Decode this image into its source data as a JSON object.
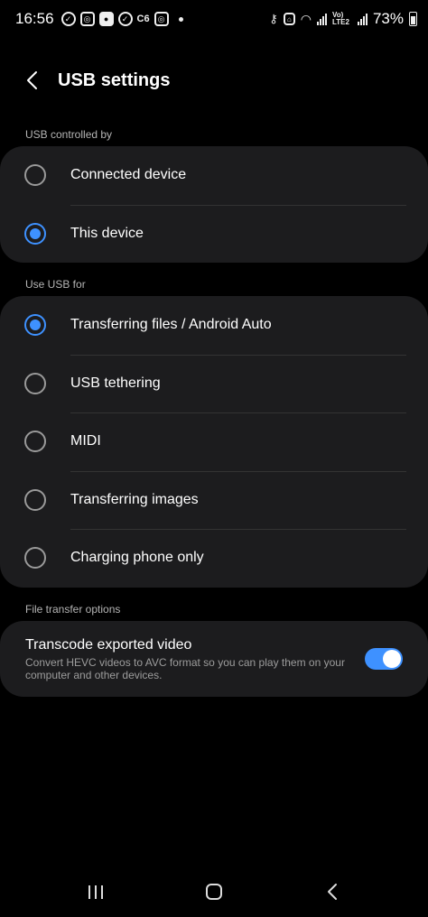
{
  "status_bar": {
    "time": "16:56",
    "notif_icons": [
      "check-circle-icon",
      "instagram-icon",
      "app-icon",
      "check-circle-icon",
      "c6-icon",
      "instagram-icon"
    ],
    "c6_text": "C6",
    "lte_text": "Vo) LTE2",
    "battery": "73%",
    "battery_level": 0.73
  },
  "header": {
    "title": "USB settings"
  },
  "sections": {
    "controlled_by": {
      "label": "USB controlled by",
      "options": [
        {
          "label": "Connected device",
          "checked": false
        },
        {
          "label": "This device",
          "checked": true
        }
      ]
    },
    "use_for": {
      "label": "Use USB for",
      "options": [
        {
          "label": "Transferring files / Android Auto",
          "checked": true
        },
        {
          "label": "USB tethering",
          "checked": false
        },
        {
          "label": "MIDI",
          "checked": false
        },
        {
          "label": "Transferring images",
          "checked": false
        },
        {
          "label": "Charging phone only",
          "checked": false
        }
      ]
    },
    "file_transfer": {
      "label": "File transfer options",
      "toggle": {
        "title": "Transcode exported video",
        "description": "Convert HEVC videos to AVC format so you can play them on your computer and other devices.",
        "on": true
      }
    }
  },
  "colors": {
    "accent": "#3e91ff",
    "card_bg": "#1c1c1e",
    "background": "#000000"
  }
}
